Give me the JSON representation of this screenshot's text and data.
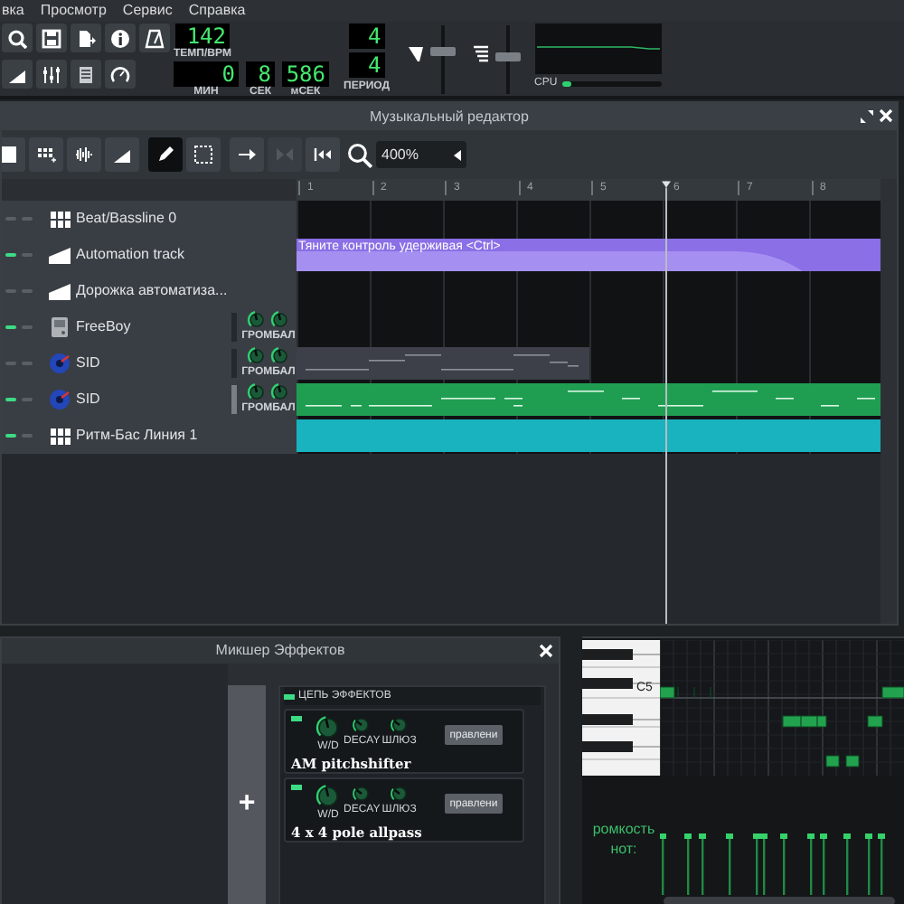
{
  "menu": [
    {
      "label": "вка"
    },
    {
      "label": "Просмотр"
    },
    {
      "label": "Сервис"
    },
    {
      "label": "Справка"
    }
  ],
  "main_toolbar": {
    "buttons": [
      {
        "kind": "recent"
      },
      {
        "kind": "save"
      },
      {
        "kind": "export"
      },
      {
        "kind": "info"
      },
      {
        "kind": "metronome"
      },
      {
        "kind": "automation"
      },
      {
        "kind": "mixer"
      },
      {
        "kind": "notes"
      },
      {
        "kind": "gauge"
      }
    ],
    "tempo": {
      "value": "142",
      "label": "ТЕМП/BPM"
    },
    "time": [
      {
        "value": "0",
        "label": "МИН"
      },
      {
        "value": "8",
        "label": "СЕК"
      },
      {
        "value": "586",
        "label": "мСЕК"
      }
    ],
    "period": {
      "numerator": "4",
      "denominator": "4",
      "label": "ПЕРИОД"
    },
    "master_volume": {
      "level": 0.65
    },
    "master_pitch": {
      "level": 0.55
    },
    "cpu": {
      "label": "CPU",
      "level": 0.08
    }
  },
  "song_editor": {
    "title": "Музыкальный редактор",
    "tools": [
      {
        "kind": "stop",
        "selected": false,
        "disabled": false
      },
      {
        "kind": "add-beat",
        "selected": false,
        "disabled": false
      },
      {
        "kind": "add-sample",
        "selected": false,
        "disabled": false
      },
      {
        "kind": "add-automation",
        "selected": false,
        "disabled": false
      },
      {
        "kind": "draw",
        "selected": true,
        "disabled": false
      },
      {
        "kind": "select",
        "selected": false,
        "disabled": false
      },
      {
        "kind": "follow",
        "selected": false,
        "disabled": false
      },
      {
        "kind": "loop",
        "selected": false,
        "disabled": true
      },
      {
        "kind": "rewind",
        "selected": false,
        "disabled": false
      }
    ],
    "zoom": "400%",
    "bars": [
      "1",
      "2",
      "3",
      "4",
      "5",
      "6",
      "7",
      "8"
    ],
    "tracks": [
      {
        "name": "Beat/Bassline 0",
        "kind": "beat",
        "active": false
      },
      {
        "name": "Automation track",
        "kind": "automation",
        "active": true,
        "clip": {
          "color": "#8a6fe6",
          "label": "Тяните контроль удерживая <Ctrl>"
        }
      },
      {
        "name": "Дорожка автоматиза...",
        "kind": "automation",
        "active": false
      },
      {
        "name": "FreeBoy",
        "kind": "instrument",
        "active": true,
        "knob_label": "ГРОМБАЛ"
      },
      {
        "name": "SID",
        "kind": "instrument",
        "active": false,
        "knob_label": "ГРОМБАЛ",
        "clip": {
          "color": "#3d4048"
        }
      },
      {
        "name": "SID",
        "kind": "instrument",
        "active": true,
        "knob_label": "ГРОМБАЛ",
        "clip": {
          "color": "#1f9e52"
        }
      },
      {
        "name": "Ритм-Бас Линия 1",
        "kind": "beat",
        "active": true,
        "clip": {
          "color": "#19b3bf"
        }
      }
    ]
  },
  "effects_mixer": {
    "title": "Микшер Эффектов",
    "chain_label": "ЦЕПЬ ЭФФЕКТОВ",
    "chain_enabled": true,
    "add_button": "+",
    "effects": [
      {
        "name": "AM pitchshifter",
        "enabled": true,
        "knobs": [
          {
            "label": "W/D"
          },
          {
            "label": "DECAY"
          },
          {
            "label": "ШЛЮЗ"
          }
        ],
        "button": "правлени"
      },
      {
        "name": "4 x 4 pole allpass",
        "enabled": true,
        "knobs": [
          {
            "label": "W/D"
          },
          {
            "label": "DECAY"
          },
          {
            "label": "ШЛЮЗ"
          }
        ],
        "button": "правлени"
      }
    ]
  },
  "piano_roll": {
    "key_label": "C5",
    "velocity_label": "ромкость нот:"
  }
}
